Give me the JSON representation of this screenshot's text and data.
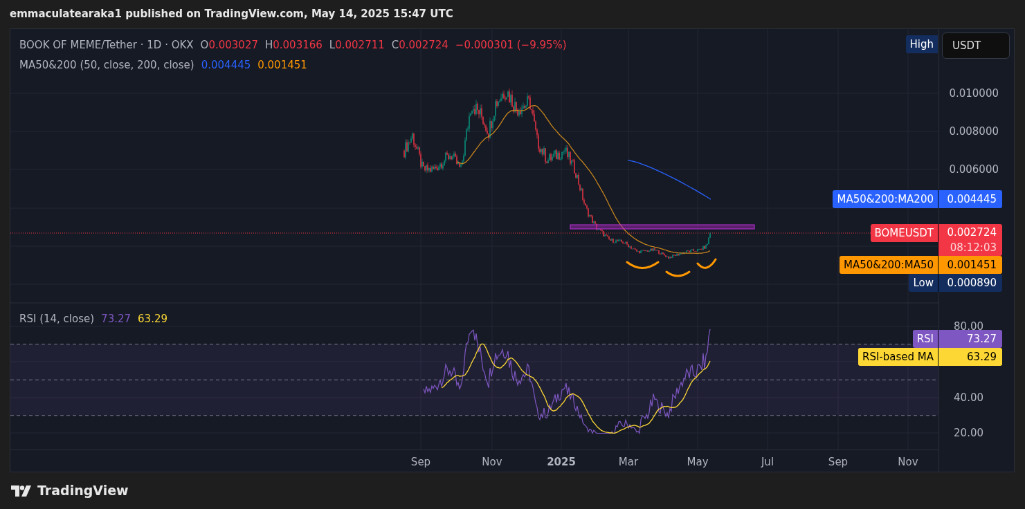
{
  "header": "emmaculatearaka1 published on TradingView.com, May 14, 2025 15:47 UTC",
  "legend": {
    "symbol": "BOOK OF MEME/Tether · 1D · OKX",
    "ohlc": [
      {
        "label": "O",
        "value": "0.003027"
      },
      {
        "label": "H",
        "value": "0.003166"
      },
      {
        "label": "L",
        "value": "0.002711"
      },
      {
        "label": "C",
        "value": "0.002724"
      }
    ],
    "change": "−0.000301 (−9.95%)"
  },
  "ma_legend": {
    "name": "MA50&200 (50, close, 200, close)",
    "values": [
      {
        "text": "0.004445",
        "color": "#2962ff"
      },
      {
        "text": "0.001451",
        "color": "#ff9800"
      }
    ]
  },
  "currency_button": "USDT",
  "price_axis": {
    "ticks": [
      "0.010000",
      "0.008000",
      "0.006000"
    ]
  },
  "price_labels": [
    {
      "label": "High",
      "color": "#132d5e"
    },
    {
      "label": "MA50&200:MA200",
      "value": "0.004445",
      "color": "#2962ff"
    },
    {
      "label": "BOMEUSDT",
      "value": "0.002724",
      "countdown": "08:12:03",
      "color": "#f23645"
    },
    {
      "label": "MA50&200:MA50",
      "value": "0.001451",
      "color": "#ff9800"
    },
    {
      "label": "Low",
      "value": "0.000890",
      "color": "#132d5e"
    }
  ],
  "rsi": {
    "legend": "RSI (14, close)",
    "values": [
      {
        "text": "73.27",
        "color": "#7e57c2"
      },
      {
        "text": "63.29",
        "color": "#fdd835"
      }
    ],
    "axis_ticks": [
      "80.00",
      "40.00",
      "20.00"
    ],
    "labels": [
      {
        "label": "RSI",
        "value": "73.27",
        "color": "#7e57c2"
      },
      {
        "label": "RSI-based MA",
        "value": "63.29",
        "color": "#fdd835"
      }
    ]
  },
  "time_axis": [
    {
      "label": "Sep",
      "kind": "month"
    },
    {
      "label": "Nov",
      "kind": "month"
    },
    {
      "label": "2025",
      "kind": "year"
    },
    {
      "label": "Mar",
      "kind": "month"
    },
    {
      "label": "May",
      "kind": "month"
    },
    {
      "label": "Jul",
      "kind": "month"
    },
    {
      "label": "Sep",
      "kind": "month"
    },
    {
      "label": "Nov",
      "kind": "month"
    }
  ],
  "footer": {
    "brand": "TradingView"
  }
}
